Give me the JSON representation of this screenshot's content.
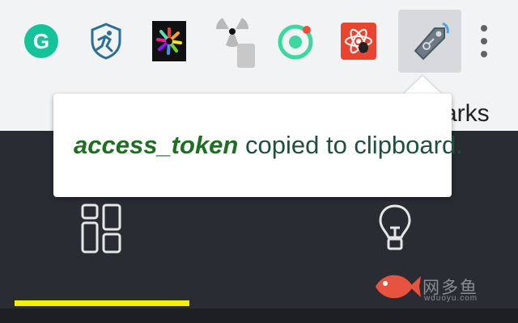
{
  "toolbar": {
    "extensions": [
      {
        "name": "grammarly-extension-icon"
      },
      {
        "name": "shield-runner-extension-icon"
      },
      {
        "name": "colorful-wheel-extension-icon"
      },
      {
        "name": "radiation-extension-icon"
      },
      {
        "name": "ionic-ring-extension-icon"
      },
      {
        "name": "react-bug-extension-icon"
      },
      {
        "name": "token-tag-extension-icon",
        "active": true
      }
    ],
    "menu_icon": "kebab-menu-icon",
    "bookmarks_fragment": "arks"
  },
  "popup": {
    "token_name": "access_token",
    "message_rest": " copied to clipboard."
  },
  "panel": {
    "nav": [
      {
        "icon": "dashboard-icon"
      },
      {
        "icon": "lightbulb-icon"
      }
    ]
  },
  "watermark": {
    "text": "网多鱼",
    "subtext": "wduoyu.com"
  },
  "colors": {
    "toolbar_bg": "#f1f3f4",
    "panel_bg": "#292c33",
    "active_indicator": "#f3f200",
    "token_text": "#1e6f22",
    "message_text": "#1f4f3f",
    "watermark_fish": "#e7533f"
  }
}
